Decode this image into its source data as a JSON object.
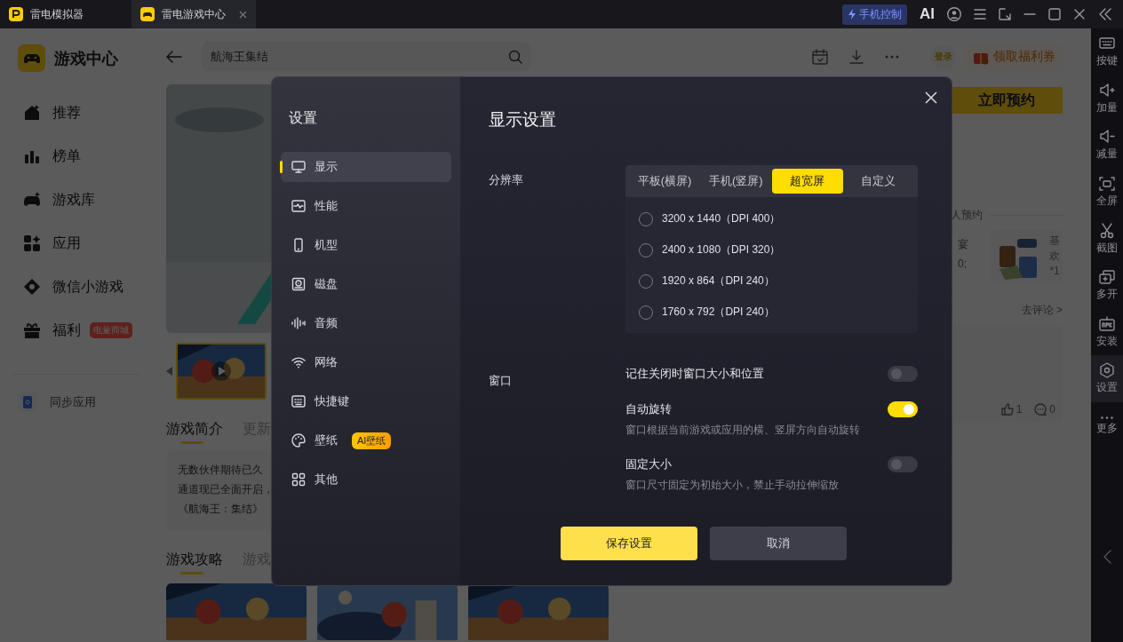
{
  "title_bar": {
    "tabs": [
      {
        "label": "雷电模拟器",
        "selected": false
      },
      {
        "label": "雷电游戏中心",
        "selected": true
      }
    ],
    "phone_control": "手机控制",
    "ai_label": "AI"
  },
  "sidebar": {
    "title": "游戏中心",
    "items": [
      {
        "label": "推荐"
      },
      {
        "label": "榜单"
      },
      {
        "label": "游戏库"
      },
      {
        "label": "应用"
      },
      {
        "label": "微信小游戏"
      },
      {
        "label": "福利",
        "badge": "电量商城"
      }
    ],
    "sync": "同步应用"
  },
  "header": {
    "search": "航海王集结",
    "login": "登录",
    "coupon": "领取福利券"
  },
  "content": {
    "intro_tabs": [
      {
        "label": "游戏简介",
        "selected": true
      },
      {
        "label": "更新",
        "selected": false
      }
    ],
    "intro_lines": [
      "无数伙伴期待已久",
      "通道现已全面开启，",
      "《航海王：集结》"
    ],
    "guide_tabs": [
      {
        "label": "游戏攻略",
        "selected": true
      },
      {
        "label": "游戏",
        "selected": false
      }
    ],
    "reserve_button": "立即预约",
    "reserve_count": "人预约",
    "cards": [
      {
        "lines": [
          "宴",
          "0;"
        ]
      },
      {
        "lines": [
          "基",
          "欢",
          "*1"
        ]
      }
    ],
    "comment_link": "去评论 >",
    "likes": "1",
    "comments": "0"
  },
  "toolbar": [
    {
      "label": "按键",
      "selected": false
    },
    {
      "label": "加量",
      "selected": false
    },
    {
      "label": "减量",
      "selected": false
    },
    {
      "label": "全屏",
      "selected": false
    },
    {
      "label": "截图",
      "selected": false
    },
    {
      "label": "多开",
      "selected": false
    },
    {
      "label": "安装",
      "selected": false
    },
    {
      "label": "设置",
      "selected": true
    },
    {
      "label": "更多",
      "selected": false
    }
  ],
  "settings_dialog": {
    "title": "设置",
    "nav": [
      {
        "label": "显示",
        "selected": true
      },
      {
        "label": "性能",
        "selected": false
      },
      {
        "label": "机型",
        "selected": false
      },
      {
        "label": "磁盘",
        "selected": false
      },
      {
        "label": "音频",
        "selected": false
      },
      {
        "label": "网络",
        "selected": false
      },
      {
        "label": "快捷键",
        "selected": false
      },
      {
        "label": "壁纸",
        "selected": false,
        "badge": "AI壁纸"
      },
      {
        "label": "其他",
        "selected": false
      }
    ],
    "heading": "显示设置",
    "resolution": {
      "label": "分辨率",
      "tabs": [
        {
          "label": "平板(横屏)",
          "selected": false
        },
        {
          "label": "手机(竖屏)",
          "selected": false
        },
        {
          "label": "超宽屏",
          "selected": true
        },
        {
          "label": "自定义",
          "selected": false
        }
      ],
      "options": [
        {
          "label": "3200 x 1440（DPI 400）",
          "selected": false
        },
        {
          "label": "2400 x 1080（DPI 320）",
          "selected": false
        },
        {
          "label": "1920 x 864（DPI 240）",
          "selected": false
        },
        {
          "label": "1760 x 792（DPI 240）",
          "selected": false
        }
      ]
    },
    "window": {
      "label": "窗口",
      "toggles": [
        {
          "label": "记住关闭时窗口大小和位置",
          "on": false
        },
        {
          "label": "自动旋转",
          "description": "窗口根据当前游戏或应用的横、竖屏方向自动旋转",
          "on": true
        },
        {
          "label": "固定大小",
          "description": "窗口尺寸固定为初始大小，禁止手动拉伸缩放",
          "on": false
        }
      ]
    },
    "buttons": [
      {
        "label": "保存设置",
        "kind": "primary"
      },
      {
        "label": "取消",
        "kind": "secondary"
      }
    ]
  }
}
